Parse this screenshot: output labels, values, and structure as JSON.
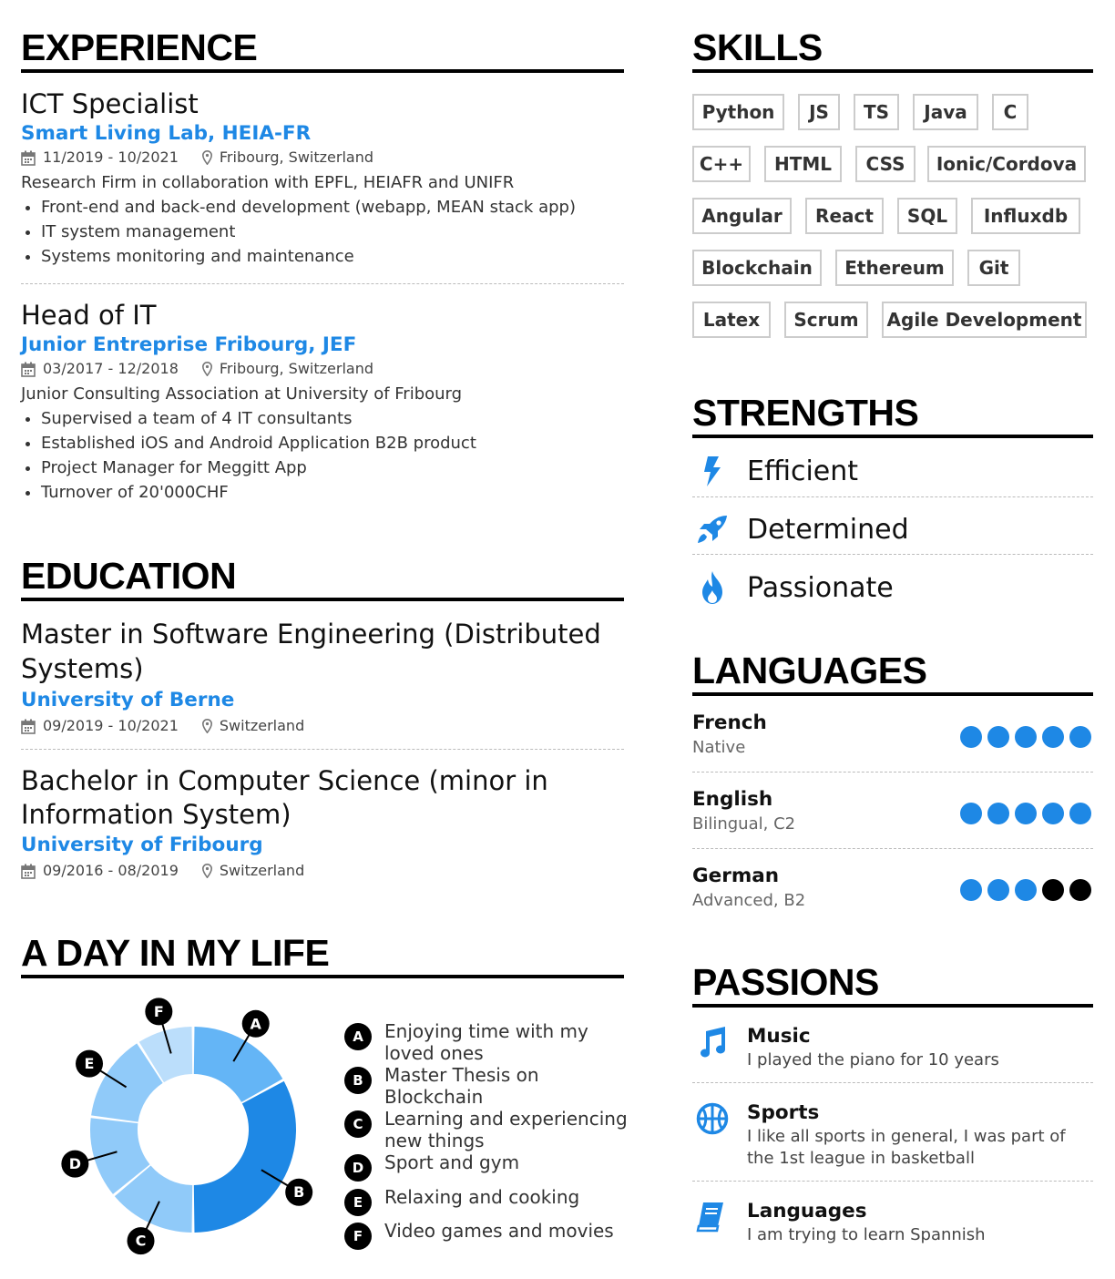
{
  "experience": {
    "heading": "EXPERIENCE",
    "jobs": [
      {
        "title": "ICT Specialist",
        "org": "Smart Living Lab, HEIA-FR",
        "dates": "11/2019 - 10/2021",
        "location": "Fribourg, Switzerland",
        "desc": "Research Firm in collaboration with EPFL, HEIAFR and UNIFR",
        "bullets": [
          "Front-end and back-end development (webapp, MEAN stack app)",
          "IT system management",
          "Systems monitoring and maintenance"
        ]
      },
      {
        "title": "Head of IT",
        "org": "Junior Entreprise Fribourg, JEF",
        "dates": "03/2017 - 12/2018",
        "location": "Fribourg, Switzerland",
        "desc": "Junior Consulting Association at University of Fribourg",
        "bullets": [
          "Supervised a team of 4 IT consultants",
          "Established iOS and Android Application B2B product",
          "Project Manager for Meggitt App",
          "Turnover of 20'000CHF"
        ]
      }
    ]
  },
  "education": {
    "heading": "EDUCATION",
    "items": [
      {
        "title": "Master in Software Engineering (Distributed Systems)",
        "org": "University of Berne",
        "dates": "09/2019 - 10/2021",
        "location": "Switzerland"
      },
      {
        "title": "Bachelor in Computer Science (minor in Information System)",
        "org": "University of Fribourg",
        "dates": "09/2016 - 08/2019",
        "location": "Switzerland"
      }
    ]
  },
  "day": {
    "heading": "A DAY IN MY LIFE",
    "legend": [
      {
        "key": "A",
        "label": "Enjoying time with my loved ones"
      },
      {
        "key": "B",
        "label": "Master Thesis on Blockchain"
      },
      {
        "key": "C",
        "label": "Learning and experiencing new things"
      },
      {
        "key": "D",
        "label": "Sport and gym"
      },
      {
        "key": "E",
        "label": "Relaxing and cooking"
      },
      {
        "key": "F",
        "label": "Video games and movies"
      }
    ]
  },
  "chart_data": {
    "type": "pie",
    "categories": [
      "A",
      "B",
      "C",
      "D",
      "E",
      "F"
    ],
    "values": [
      17,
      33,
      14,
      13,
      14,
      9
    ],
    "colors": [
      "#64b5f6",
      "#1e88e5",
      "#90caf9",
      "#90caf9",
      "#90caf9",
      "#bbdefb"
    ],
    "legend": "right"
  },
  "skills": {
    "heading": "SKILLS",
    "tags": [
      "Python",
      "JS",
      "TS",
      "Java",
      "C",
      "C++",
      "HTML",
      "CSS",
      "Ionic/Cordova",
      "Angular",
      "React",
      "SQL",
      "Influxdb",
      "Blockchain",
      "Ethereum",
      "Git",
      "Latex",
      "Scrum",
      "Agile Development"
    ]
  },
  "strengths": {
    "heading": "STRENGTHS",
    "items": [
      {
        "label": "Efficient",
        "icon": "bolt-icon"
      },
      {
        "label": "Determined",
        "icon": "rocket-icon"
      },
      {
        "label": "Passionate",
        "icon": "fire-icon"
      }
    ]
  },
  "languages": {
    "heading": "LANGUAGES",
    "items": [
      {
        "name": "French",
        "level": "Native",
        "rating": 5,
        "max": 5
      },
      {
        "name": "English",
        "level": "Bilingual, C2",
        "rating": 5,
        "max": 5
      },
      {
        "name": "German",
        "level": "Advanced, B2",
        "rating": 3,
        "max": 5
      }
    ]
  },
  "passions": {
    "heading": "PASSIONS",
    "items": [
      {
        "name": "Music",
        "desc": "I played the piano for 10 years",
        "icon": "music-note-icon"
      },
      {
        "name": "Sports",
        "desc": "I like all sports in general, I was part of the 1st league in basketball",
        "icon": "basketball-icon"
      },
      {
        "name": "Languages",
        "desc": "I am trying to learn Spannish",
        "icon": "book-icon"
      }
    ]
  },
  "colors": {
    "accent": "#1e88e5",
    "text": "#222222",
    "rule": "#000000"
  }
}
